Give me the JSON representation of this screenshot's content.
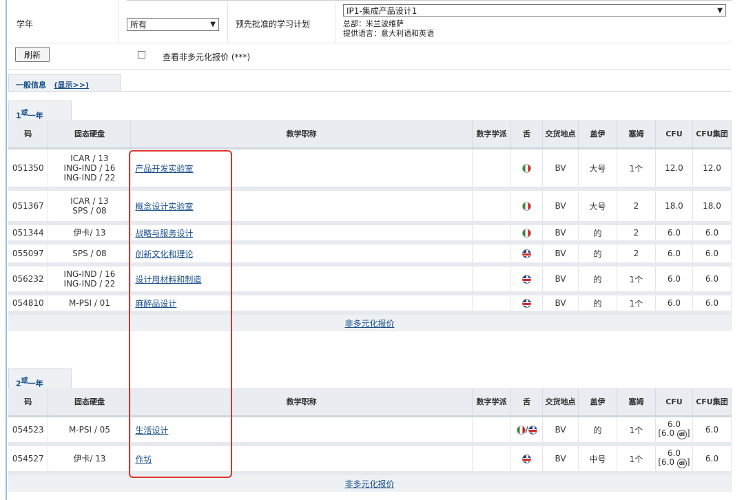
{
  "filters": {
    "academic_year_label": "学年",
    "academic_year_value": "所有",
    "study_plan_label": "预先批准的学习计划",
    "study_plan_value": "IP1-集成产品设计1",
    "study_plan_info1": "总部：米兰波维萨",
    "study_plan_info2": "提供语言：意大利语和英语",
    "refresh_label": "刷新",
    "non_diversified_label": "查看非多元化报价 (***)"
  },
  "general_tab": {
    "label": "一般信息",
    "toggle": "(显示>>)"
  },
  "columns": [
    "码",
    "固态硬盘",
    "教学职称",
    "数字学派",
    "舌",
    "交货地点",
    "盖伊",
    "塞姆",
    "CFU",
    "CFU集团"
  ],
  "years": [
    {
      "num": "1",
      "sup": "或",
      "suffix": "一年",
      "rows": [
        {
          "code": "051350",
          "ssd": [
            "ICAR / 13",
            "ING-IND / 16",
            "ING-IND / 22"
          ],
          "title": "产品开发实验室",
          "digital": "",
          "lang": "it",
          "place": "BV",
          "gai": "大号",
          "sem": "1个",
          "cfu": "12.0",
          "cfu_group": "12.0"
        },
        {
          "code": "051367",
          "ssd": [
            "ICAR / 13",
            "SPS / 08"
          ],
          "title": "概念设计实验室",
          "digital": "",
          "lang": "it",
          "place": "BV",
          "gai": "大号",
          "sem": "2",
          "cfu": "18.0",
          "cfu_group": "18.0"
        },
        {
          "code": "051344",
          "ssd": [
            "伊卡/ 13"
          ],
          "title": "战略与服务设计",
          "digital": "",
          "lang": "it",
          "place": "BV",
          "gai": "的",
          "sem": "2",
          "cfu": "6.0",
          "cfu_group": "6.0"
        },
        {
          "code": "055097",
          "ssd": [
            "SPS / 08"
          ],
          "title": "创新文化和理论",
          "digital": "",
          "lang": "uk",
          "place": "BV",
          "gai": "的",
          "sem": "2",
          "cfu": "6.0",
          "cfu_group": "6.0"
        },
        {
          "code": "056232",
          "ssd": [
            "ING-IND / 16",
            "ING-IND / 22"
          ],
          "title": "设计用材料和制造",
          "digital": "",
          "lang": "uk",
          "place": "BV",
          "gai": "的",
          "sem": "1个",
          "cfu": "6.0",
          "cfu_group": "6.0"
        },
        {
          "code": "054810",
          "ssd": [
            "M-PSI / 01"
          ],
          "title": "麻醉品设计",
          "digital": "",
          "lang": "uk",
          "place": "BV",
          "gai": "的",
          "sem": "1个",
          "cfu": "6.0",
          "cfu_group": "6.0"
        }
      ],
      "footer_link": "非多元化报价"
    },
    {
      "num": "2",
      "sup": "或",
      "suffix": "一年",
      "rows": [
        {
          "code": "054523",
          "ssd": [
            "M-PSI / 05"
          ],
          "title": "生活设计",
          "digital": "",
          "lang": "it-uk",
          "place": "BV",
          "gai": "的",
          "sem": "1个",
          "cfu": "6.0",
          "cfu_sub": "[6.0 ",
          "cfu_group": "6.0"
        },
        {
          "code": "054527",
          "ssd": [
            "伊卡/ 13"
          ],
          "title": "作坊",
          "digital": "",
          "lang": "uk",
          "place": "BV",
          "gai": "中号",
          "sem": "1个",
          "cfu": "6.0",
          "cfu_sub": "[6.0 ",
          "cfu_group": "6.0"
        }
      ],
      "footer_link": "非多元化报价"
    }
  ],
  "di_badge": "di"
}
